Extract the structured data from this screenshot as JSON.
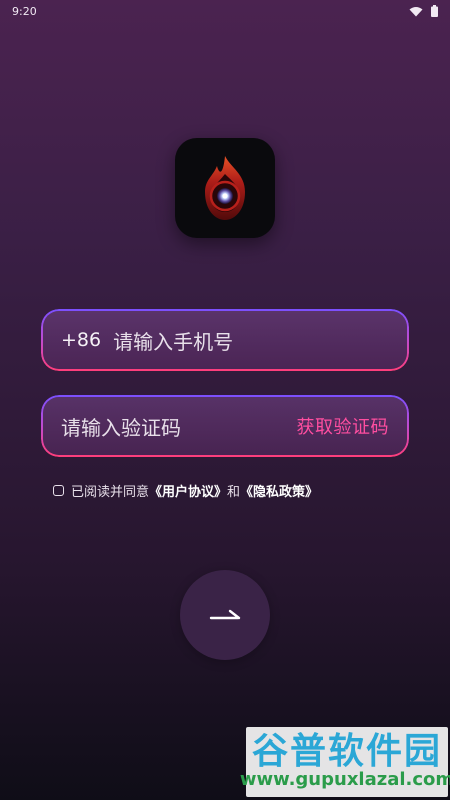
{
  "status_bar": {
    "time": "9:20",
    "icons": [
      "wifi-icon",
      "battery-icon"
    ]
  },
  "logo": {
    "icon": "flame-orb-logo"
  },
  "phone_input": {
    "country_code": "+86",
    "placeholder": "请输入手机号"
  },
  "code_input": {
    "placeholder": "请输入验证码",
    "get_code_label": "获取验证码"
  },
  "agreement": {
    "prefix": "已阅读并同意",
    "user_agreement": "《用户协议》",
    "and": "和",
    "privacy_policy": "《隐私政策》",
    "checked": false
  },
  "submit": {
    "icon": "arrow-right-icon"
  },
  "watermark": {
    "title": "谷普软件园",
    "url": "www.gupuxlazal.com"
  },
  "colors": {
    "accent": "#ff4ea0",
    "border_top": "#7b50ff",
    "border_bottom": "#ff3e7a",
    "button_bg": "#3a2347"
  }
}
